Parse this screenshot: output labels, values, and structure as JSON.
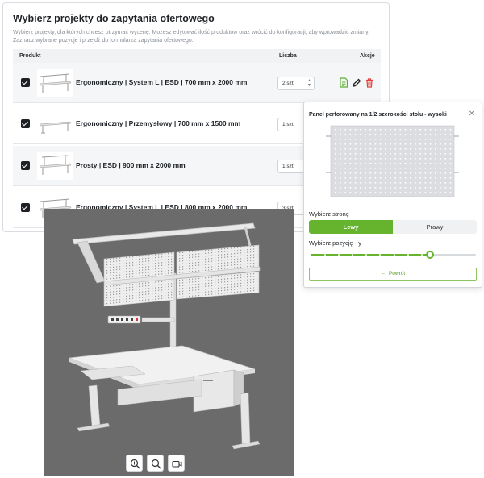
{
  "main": {
    "title": "Wybierz projekty do zapytania ofertowego",
    "description": "Wybierz projekty, dla których chcesz otrzymać wycenę. Możesz edytować ilość produktów oraz wrócić do konfiguracji, aby wprowadzić zmiany. Zaznacz wybrane pozycje i przejdź do formularza zapytania ofertowego.",
    "columns": {
      "product": "Produkt",
      "quantity": "Liczba",
      "actions": "Akcje"
    },
    "rows": [
      {
        "name": "Ergonomiczny | System L | ESD | 700 mm x 2000 mm",
        "qty": "2 szt."
      },
      {
        "name": "Ergonomiczny | Przemysłowy | 700 mm x 1500 mm",
        "qty": "1 szt."
      },
      {
        "name": "Prosty | ESD | 900 mm x 2000 mm",
        "qty": "1 szt."
      },
      {
        "name": "Ergonomiczny | System L | ESD | 800 mm x 2000 mm",
        "qty": "3 szt."
      }
    ]
  },
  "side_panel": {
    "title": "Panel perforowany na 1/2 szerokości stołu - wysoki",
    "close_icon": "close-icon",
    "side_label": "Wybierz stronę",
    "side_options": [
      "Lewy",
      "Prawy"
    ],
    "selected_side": "Lewy",
    "position_label": "Wybierz pozycję - y",
    "slider_value": 0.72,
    "back_label": "Powrót"
  },
  "viewer": {
    "controls": [
      "zoom-in-icon",
      "zoom-out-icon",
      "camera-icon"
    ]
  },
  "colors": {
    "accent": "#66b32e",
    "viewer_bg": "#6b6b6b",
    "delete": "#e0413b",
    "document": "#5bb030"
  }
}
